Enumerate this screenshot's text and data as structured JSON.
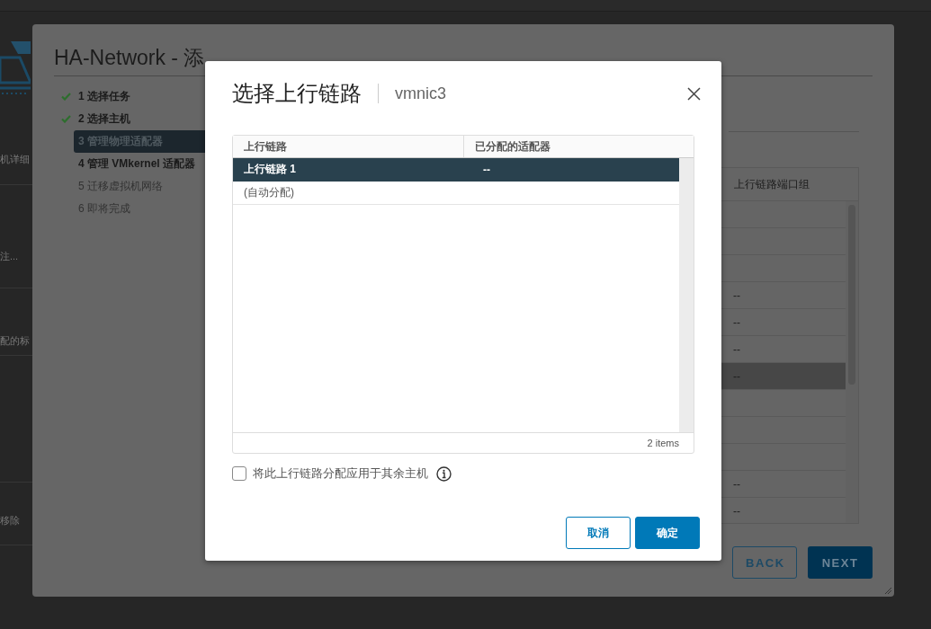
{
  "background": {
    "side_texts": [
      {
        "text": "机详细"
      },
      {
        "text": "注..."
      },
      {
        "text": "配的标"
      },
      {
        "text": "移除"
      }
    ]
  },
  "wizard": {
    "title": "HA-Network - 添",
    "steps": [
      {
        "label": "1 选择任务",
        "done": true,
        "selected": false,
        "disabled": false
      },
      {
        "label": "2 选择主机",
        "done": true,
        "selected": false,
        "disabled": false
      },
      {
        "label": "3 管理物理适配器",
        "done": false,
        "selected": true,
        "disabled": false
      },
      {
        "label": "4 管理 VMkernel 适配器",
        "done": false,
        "selected": false,
        "disabled": false
      },
      {
        "label": "5 迁移虚拟机网络",
        "done": false,
        "selected": false,
        "disabled": true
      },
      {
        "label": "6 即将完成",
        "done": false,
        "selected": false,
        "disabled": true
      }
    ],
    "table": {
      "column": "上行链路端口组",
      "rows": [
        {
          "highlighted": false
        },
        {
          "highlighted": false
        },
        {
          "highlighted": false
        },
        {
          "value": "--",
          "highlighted": false
        },
        {
          "value": "--",
          "highlighted": false
        },
        {
          "value": "--",
          "highlighted": false
        },
        {
          "value": "--",
          "highlighted": true
        },
        {
          "highlighted": false
        },
        {
          "highlighted": false
        },
        {
          "highlighted": false
        },
        {
          "value": "--",
          "highlighted": false
        },
        {
          "value": "--",
          "highlighted": false
        }
      ]
    },
    "buttons": [
      {
        "label": "BACK",
        "kind": "outline"
      },
      {
        "label": "NEXT",
        "kind": "primary"
      }
    ]
  },
  "dialog": {
    "title": "选择上行链路",
    "subtitle": "vmnic3",
    "grid": {
      "columns": [
        "上行链路",
        "已分配的适配器"
      ],
      "rows": [
        {
          "cells": [
            "上行链路 1",
            "--"
          ],
          "selected": true
        },
        {
          "cells": [
            "(自动分配)"
          ],
          "selected": false
        }
      ],
      "footer": "2 items"
    },
    "apply_all": {
      "label": "将此上行链路分配应用于其余主机",
      "checked": false
    },
    "buttons": [
      {
        "label": "取消",
        "kind": "outline"
      },
      {
        "label": "确定",
        "kind": "primary"
      }
    ]
  }
}
